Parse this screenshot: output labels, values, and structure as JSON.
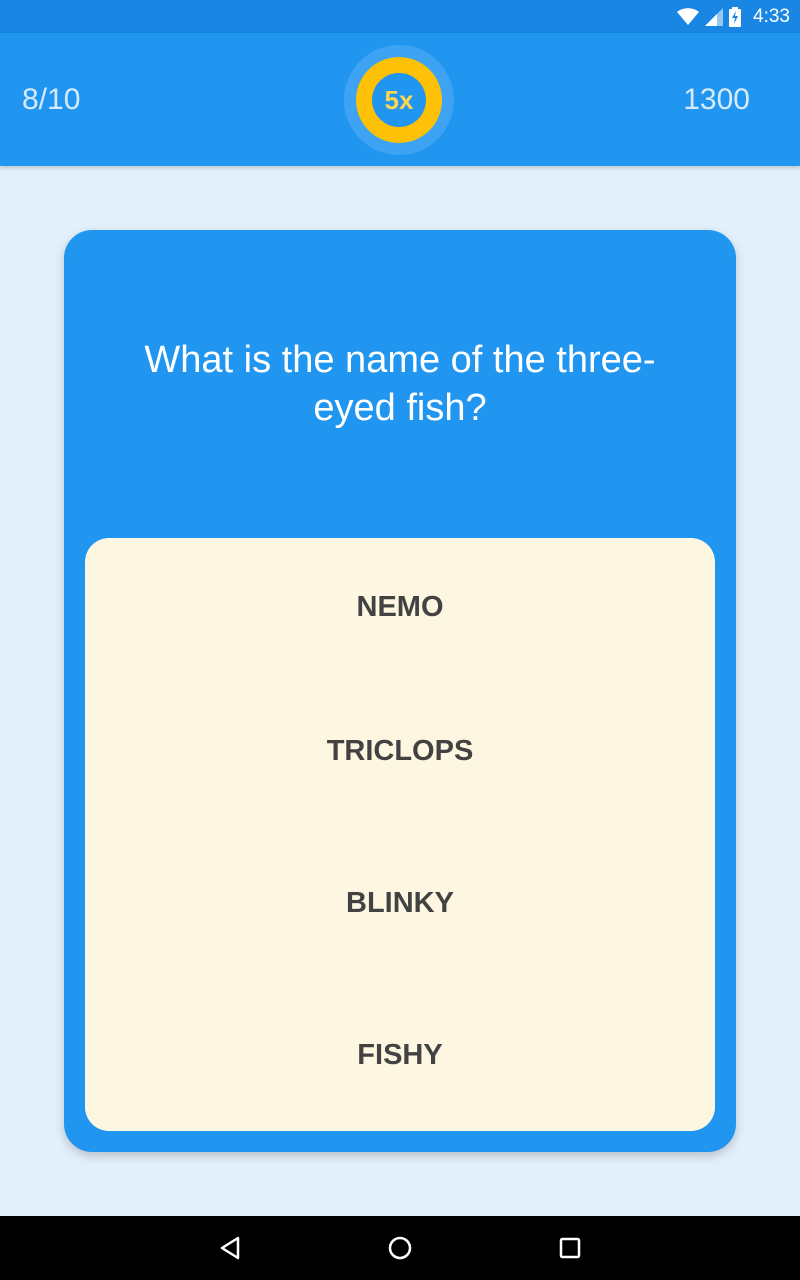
{
  "status_bar": {
    "time": "4:33",
    "icons": [
      "wifi-icon",
      "cell-signal-icon",
      "battery-charging-icon"
    ]
  },
  "header": {
    "progress": "8/10",
    "multiplier": "5x",
    "score": "1300"
  },
  "question": {
    "text": "What is the name of the three-eyed fish?"
  },
  "answers": [
    "NEMO",
    "TRICLOPS",
    "BLINKY",
    "FISHY"
  ],
  "nav_bar": {
    "icons": [
      "back-icon",
      "home-icon",
      "recents-icon"
    ]
  },
  "colors": {
    "primary": "#2196f0",
    "status_bar": "#1a86e4",
    "background": "#e3f0fb",
    "accent": "#ffc107",
    "answer_panel": "#fdf6e0",
    "answer_text": "#424242"
  }
}
